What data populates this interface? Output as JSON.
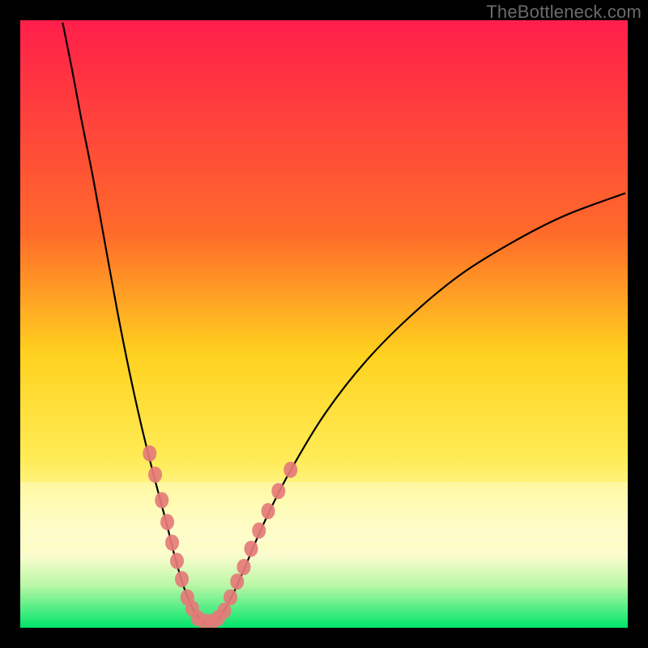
{
  "watermark": "TheBottleneck.com",
  "chart_data": {
    "type": "line",
    "title": "",
    "xlabel": "",
    "ylabel": "",
    "xlim": [
      0,
      100
    ],
    "ylim": [
      0,
      100
    ],
    "gradient_stops": [
      {
        "offset": 0,
        "color": "#ff1f4b"
      },
      {
        "offset": 35,
        "color": "#ff6a2a"
      },
      {
        "offset": 55,
        "color": "#ffd21f"
      },
      {
        "offset": 72,
        "color": "#ffeb55"
      },
      {
        "offset": 80,
        "color": "#fffa9e"
      },
      {
        "offset": 88,
        "color": "#fcfccf"
      },
      {
        "offset": 93,
        "color": "#b9f7a6"
      },
      {
        "offset": 100,
        "color": "#00e56a"
      }
    ],
    "series": [
      {
        "name": "left-curve",
        "type": "line",
        "points": [
          {
            "x": 7.0,
            "y": 99.5
          },
          {
            "x": 8.5,
            "y": 92.0
          },
          {
            "x": 10.0,
            "y": 84.0
          },
          {
            "x": 12.0,
            "y": 74.0
          },
          {
            "x": 14.0,
            "y": 63.0
          },
          {
            "x": 16.0,
            "y": 52.0
          },
          {
            "x": 18.0,
            "y": 42.0
          },
          {
            "x": 20.0,
            "y": 33.0
          },
          {
            "x": 22.0,
            "y": 25.0
          },
          {
            "x": 24.0,
            "y": 17.5
          },
          {
            "x": 25.5,
            "y": 11.5
          },
          {
            "x": 27.0,
            "y": 6.5
          },
          {
            "x": 28.5,
            "y": 3.0
          },
          {
            "x": 30.0,
            "y": 1.0
          }
        ]
      },
      {
        "name": "right-curve",
        "type": "line",
        "points": [
          {
            "x": 30.0,
            "y": 1.0
          },
          {
            "x": 31.5,
            "y": 1.0
          },
          {
            "x": 33.0,
            "y": 2.0
          },
          {
            "x": 35.0,
            "y": 5.5
          },
          {
            "x": 37.0,
            "y": 10.0
          },
          {
            "x": 40.0,
            "y": 17.0
          },
          {
            "x": 44.0,
            "y": 25.0
          },
          {
            "x": 50.0,
            "y": 35.0
          },
          {
            "x": 57.0,
            "y": 44.0
          },
          {
            "x": 65.0,
            "y": 52.0
          },
          {
            "x": 73.0,
            "y": 58.5
          },
          {
            "x": 82.0,
            "y": 64.0
          },
          {
            "x": 90.0,
            "y": 68.0
          },
          {
            "x": 99.5,
            "y": 71.5
          }
        ]
      },
      {
        "name": "dots-left",
        "type": "scatter",
        "color": "#e57b78",
        "points": [
          {
            "x": 21.3,
            "y": 28.7
          },
          {
            "x": 22.2,
            "y": 25.2
          },
          {
            "x": 23.3,
            "y": 21.0
          },
          {
            "x": 24.2,
            "y": 17.4
          },
          {
            "x": 25.0,
            "y": 14.0
          },
          {
            "x": 25.8,
            "y": 11.0
          },
          {
            "x": 26.6,
            "y": 8.0
          },
          {
            "x": 27.5,
            "y": 5.0
          },
          {
            "x": 28.3,
            "y": 3.2
          }
        ]
      },
      {
        "name": "dots-bottom",
        "type": "scatter",
        "color": "#e57b78",
        "points": [
          {
            "x": 29.2,
            "y": 1.6
          },
          {
            "x": 30.4,
            "y": 1.0
          },
          {
            "x": 31.6,
            "y": 1.0
          },
          {
            "x": 32.6,
            "y": 1.6
          },
          {
            "x": 33.6,
            "y": 2.8
          }
        ]
      },
      {
        "name": "dots-right",
        "type": "scatter",
        "color": "#e57b78",
        "points": [
          {
            "x": 34.6,
            "y": 5.0
          },
          {
            "x": 35.7,
            "y": 7.6
          },
          {
            "x": 36.8,
            "y": 10.0
          },
          {
            "x": 38.0,
            "y": 13.0
          },
          {
            "x": 39.3,
            "y": 16.0
          },
          {
            "x": 40.8,
            "y": 19.2
          },
          {
            "x": 42.5,
            "y": 22.5
          },
          {
            "x": 44.5,
            "y": 26.0
          }
        ]
      }
    ]
  }
}
